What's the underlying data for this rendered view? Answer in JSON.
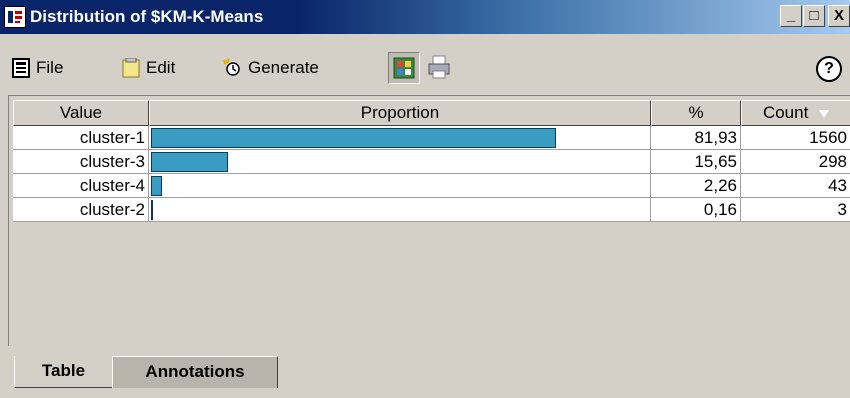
{
  "window": {
    "title": "Distribution of $KM-K-Means",
    "controls": [
      "_",
      "□",
      "X"
    ]
  },
  "menubar": {
    "file": "File",
    "edit": "Edit",
    "generate": "Generate",
    "help": "?"
  },
  "table": {
    "headers": [
      "Value",
      "Proportion",
      "%",
      "Count"
    ],
    "sort_column": "Count",
    "rows": [
      {
        "value": "cluster-1",
        "percent": "81,93",
        "count": "1560",
        "proportion": 0.8193
      },
      {
        "value": "cluster-3",
        "percent": "15,65",
        "count": "298",
        "proportion": 0.1565
      },
      {
        "value": "cluster-4",
        "percent": "2,26",
        "count": "43",
        "proportion": 0.0226
      },
      {
        "value": "cluster-2",
        "percent": "0,16",
        "count": "3",
        "proportion": 0.0016
      }
    ],
    "bar_color": "#3a9cc0"
  },
  "tabs": [
    {
      "label": "Table",
      "active": true
    },
    {
      "label": "Annotations",
      "active": false
    }
  ]
}
